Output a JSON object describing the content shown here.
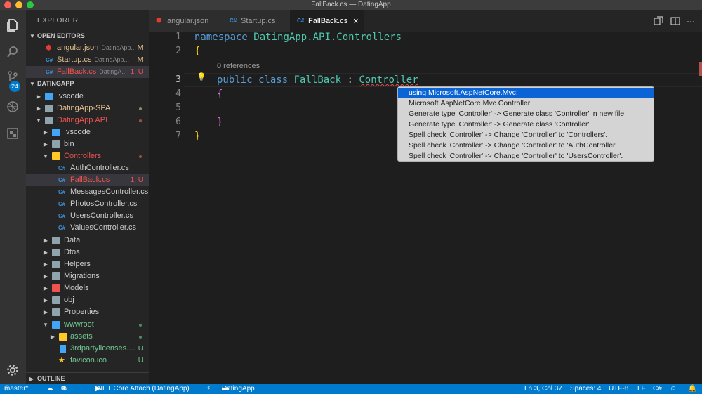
{
  "window": {
    "title": "FallBack.cs — DatingApp"
  },
  "activity_bar": {
    "items": [
      "explorer-icon",
      "search-icon",
      "source-control-icon",
      "debug-icon",
      "extensions-icon"
    ],
    "scm_badge": "24",
    "settings": "gear-icon"
  },
  "sidebar": {
    "title": "EXPLORER",
    "open_editors": {
      "label": "OPEN EDITORS",
      "items": [
        {
          "name": "angular.json",
          "path": "DatingApp...",
          "status": "M"
        },
        {
          "name": "Startup.cs",
          "path": "DatingApp...",
          "status": "M"
        },
        {
          "name": "FallBack.cs",
          "path": "DatingA...",
          "status": "1, U"
        }
      ]
    },
    "workspace": {
      "label": "DATINGAPP",
      "items": [
        {
          "name": ".vscode"
        },
        {
          "name": "DatingApp-SPA"
        },
        {
          "name": "DatingApp.API"
        },
        {
          "name": ".vscode"
        },
        {
          "name": "bin"
        },
        {
          "name": "Controllers"
        },
        {
          "name": "AuthController.cs"
        },
        {
          "name": "FallBack.cs",
          "status": "1, U"
        },
        {
          "name": "MessagesController.cs"
        },
        {
          "name": "PhotosController.cs"
        },
        {
          "name": "UsersController.cs"
        },
        {
          "name": "ValuesController.cs"
        },
        {
          "name": "Data"
        },
        {
          "name": "Dtos"
        },
        {
          "name": "Helpers"
        },
        {
          "name": "Migrations"
        },
        {
          "name": "Models"
        },
        {
          "name": "obj"
        },
        {
          "name": "Properties"
        },
        {
          "name": "wwwroot"
        },
        {
          "name": "assets"
        },
        {
          "name": "3rdpartylicenses....",
          "status": "U"
        },
        {
          "name": "favicon.ico",
          "status": "U"
        }
      ]
    },
    "outline_label": "OUTLINE"
  },
  "tabs": [
    {
      "label": "angular.json",
      "icon": "angular-icon"
    },
    {
      "label": "Startup.cs",
      "icon": "C#"
    },
    {
      "label": "FallBack.cs",
      "icon": "C#",
      "close": "×"
    }
  ],
  "editor": {
    "line_numbers": [
      "1",
      "2",
      "3",
      "4",
      "5",
      "6",
      "7"
    ],
    "codelens": "0 references",
    "lines": {
      "l1_kw": "namespace",
      "l1_ns": "DatingApp.API.Controllers",
      "l2": "{",
      "l3_kw1": "public",
      "l3_kw2": "class",
      "l3_cls": "FallBack",
      "l3_colon": ":",
      "l3_base": "Controller",
      "l4": "{",
      "l6": "}",
      "l7": "}"
    }
  },
  "quick_fix": {
    "items": [
      "using Microsoft.AspNetCore.Mvc;",
      "Microsoft.AspNetCore.Mvc.Controller",
      "Generate type 'Controller' -> Generate class 'Controller' in new file",
      "Generate type 'Controller' -> Generate class 'Controller'",
      "Spell check 'Controller' -> Change 'Controller' to 'Controllers'.",
      "Spell check 'Controller' -> Change 'Controller' to 'AuthController'.",
      "Spell check 'Controller' -> Change 'Controller' to 'UsersController'."
    ]
  },
  "status_bar": {
    "branch": "master*",
    "errors": "1",
    "warnings": "0",
    "debug": ".NET Core Attach (DatingApp)",
    "folder": "DatingApp",
    "position": "Ln 3, Col 37",
    "spaces": "Spaces: 4",
    "encoding": "UTF-8",
    "eol": "LF",
    "language": "C#"
  },
  "colors": {
    "accent": "#007acc",
    "selection": "#0a64d6",
    "error": "#f14c4c"
  }
}
